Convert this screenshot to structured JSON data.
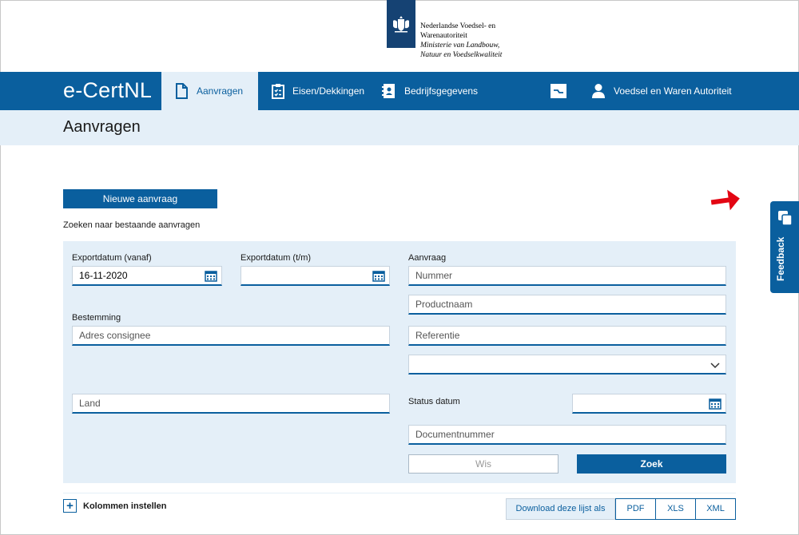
{
  "header": {
    "org_line1": "Nederlandse Voedsel- en",
    "org_line2": "Warenautoriteit",
    "ministry_line1": "Ministerie van Landbouw,",
    "ministry_line2": "Natuur en Voedselkwaliteit",
    "logo_icon": "coat-of-arms-icon"
  },
  "nav": {
    "brand": "e-CertNL",
    "items": [
      {
        "label": "Aanvragen",
        "icon": "document-icon",
        "active": true
      },
      {
        "label": "Eisen/Dekkingen",
        "icon": "clipboard-checklist-icon"
      },
      {
        "label": "Bedrijfsgegevens",
        "icon": "address-book-icon"
      }
    ],
    "export_icon": "export-icon",
    "user_label": "Voedsel en Waren Autoriteit",
    "user_icon": "user-icon"
  },
  "page": {
    "title": "Aanvragen",
    "new_button": "Nieuwe aanvraag",
    "search_label": "Zoeken naar bestaande aanvragen"
  },
  "search": {
    "export_from_label": "Exportdatum (vanaf)",
    "export_from_value": "16-11-2020",
    "export_to_label": "Exportdatum (t/m)",
    "export_to_value": "",
    "destination_label": "Bestemming",
    "consignee_placeholder": "Adres consignee",
    "country_placeholder": "Land",
    "request_label": "Aanvraag",
    "number_placeholder": "Nummer",
    "product_placeholder": "Productnaam",
    "reference_placeholder": "Referentie",
    "status_select_value": "",
    "status_date_label": "Status datum",
    "status_date_value": "",
    "document_number_placeholder": "Documentnummer",
    "clear_button": "Wis",
    "search_button": "Zoek"
  },
  "bottom": {
    "columns_label": "Kolommen instellen",
    "download_label": "Download deze lijst als",
    "formats": [
      "PDF",
      "XLS",
      "XML"
    ]
  },
  "feedback": {
    "label": "Feedback",
    "icon": "chat-bubbles-icon"
  },
  "colors": {
    "primary": "#0a5f9e",
    "light_band": "#e4eff8",
    "annotation_arrow": "#e30613"
  }
}
